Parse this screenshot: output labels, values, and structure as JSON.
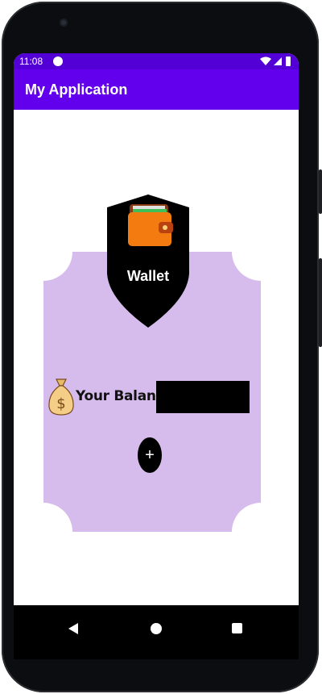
{
  "status_bar": {
    "time": "11:08"
  },
  "app_bar": {
    "title": "My Application"
  },
  "wallet": {
    "label": "Wallet"
  },
  "balance": {
    "label": "Your Balance"
  },
  "add_button": {
    "label": "+"
  },
  "colors": {
    "status_bar": "#5200d6",
    "app_bar": "#6200ee",
    "card": "#d6bcec",
    "shield": "#000000"
  },
  "icons": {
    "wallet": "wallet-icon",
    "money": "money-bag-icon",
    "back": "back-triangle-icon",
    "home": "home-circle-icon",
    "recents": "recents-square-icon"
  }
}
